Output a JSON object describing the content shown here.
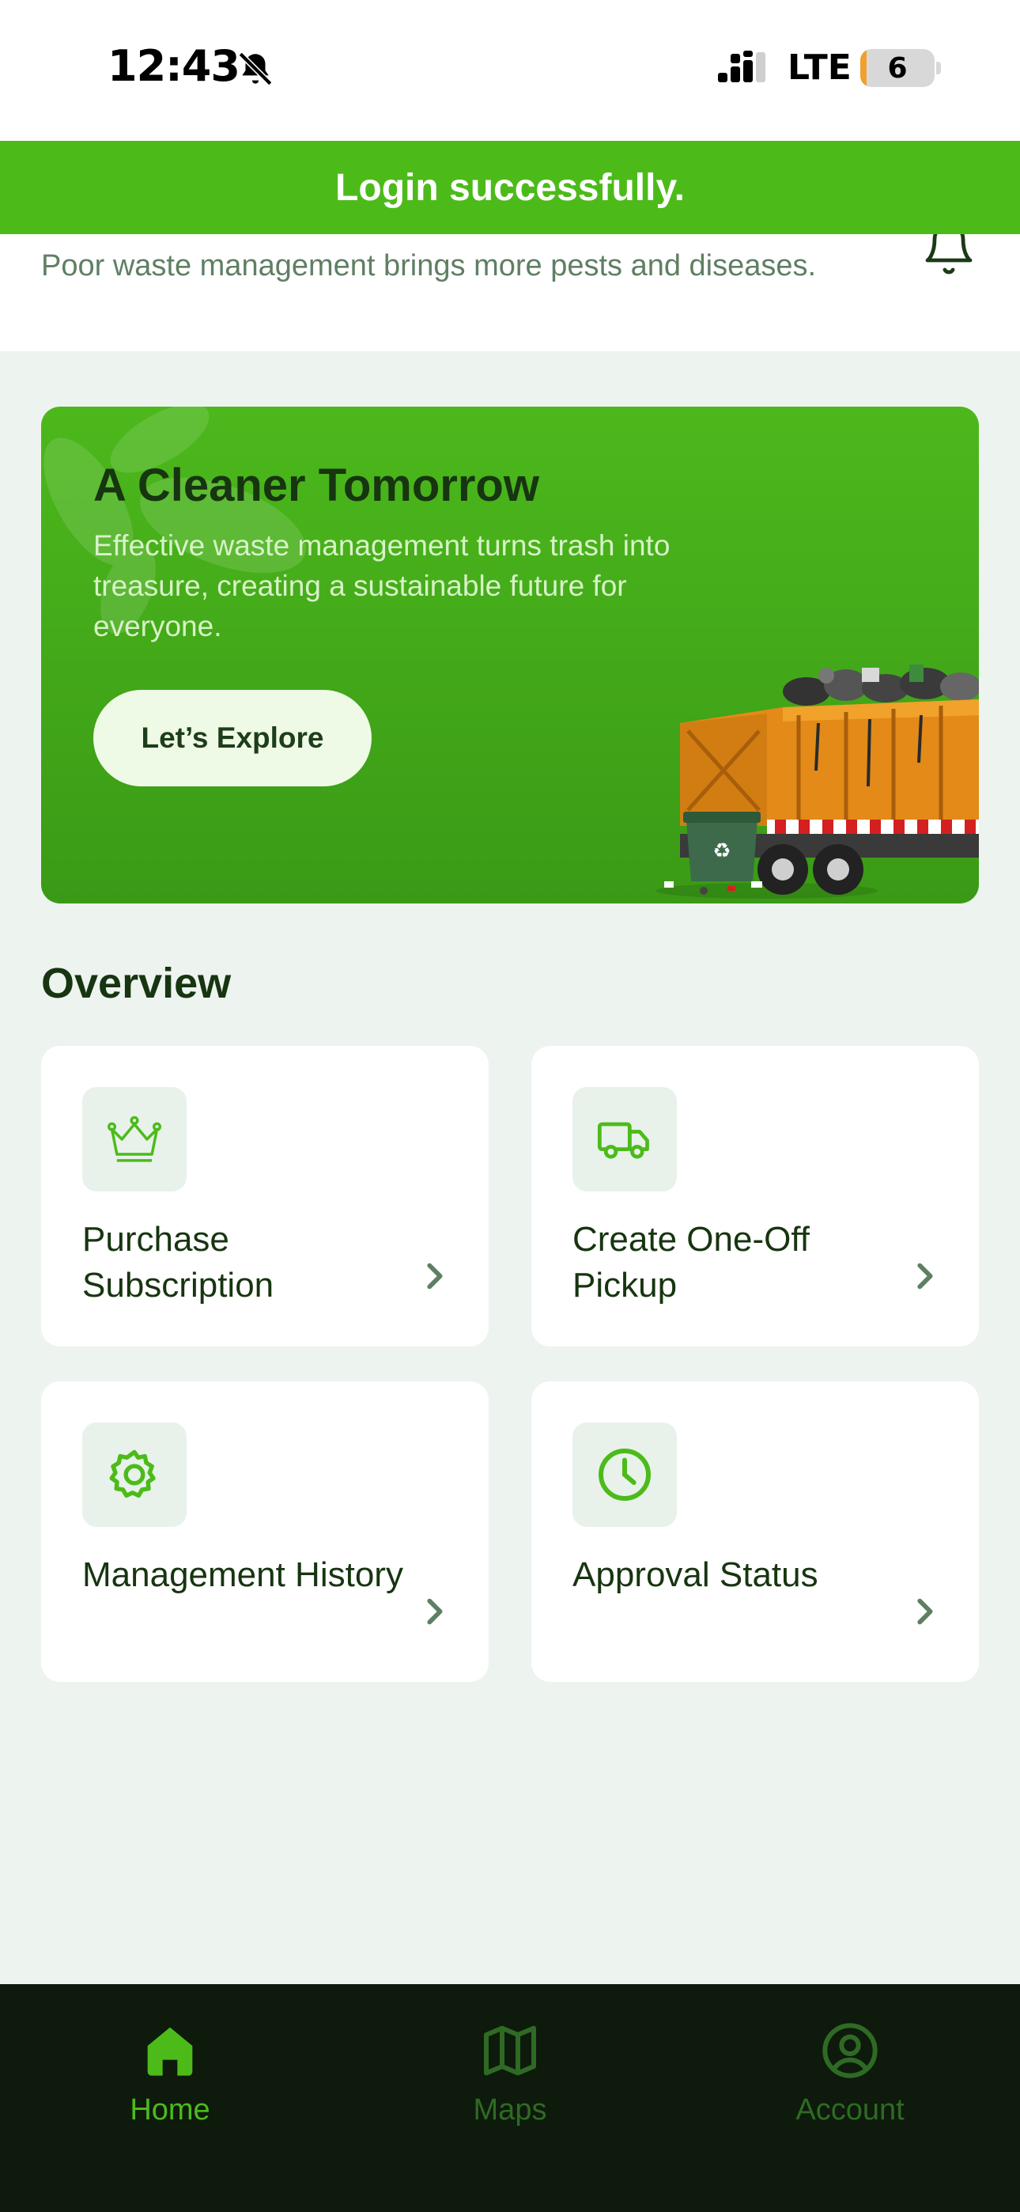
{
  "status_bar": {
    "time": "12:43",
    "network": "LTE",
    "battery": "6",
    "icons": [
      "bell-slash-icon",
      "signal-icon",
      "battery-icon"
    ]
  },
  "header": {
    "subtitle": "Poor waste management brings more pests and diseases.",
    "icon": "bell-icon"
  },
  "toast": {
    "message": "Login successfully."
  },
  "hero": {
    "title": "A Cleaner Tomorrow",
    "description": "Effective waste management turns trash into treasure, creating a sustainable future for everyone.",
    "button_label": "Let’s Explore"
  },
  "overview": {
    "title": "Overview",
    "cards": [
      {
        "label": "Purchase Subscription",
        "icon": "crown-icon"
      },
      {
        "label": "Create One-Off Pickup",
        "icon": "truck-icon"
      },
      {
        "label": "Management History",
        "icon": "gear-icon"
      },
      {
        "label": "Approval Status",
        "icon": "clock-icon"
      }
    ]
  },
  "bottom_nav": {
    "items": [
      {
        "label": "Home",
        "icon": "home-icon",
        "active": true
      },
      {
        "label": "Maps",
        "icon": "map-icon",
        "active": false
      },
      {
        "label": "Account",
        "icon": "account-icon",
        "active": false
      }
    ]
  },
  "colors": {
    "brand_green": "#4cbb1a",
    "dark_green": "#173510",
    "background": "#edf3ef",
    "nav_background": "#0e1a0c",
    "nav_inactive": "#2f6a24"
  }
}
